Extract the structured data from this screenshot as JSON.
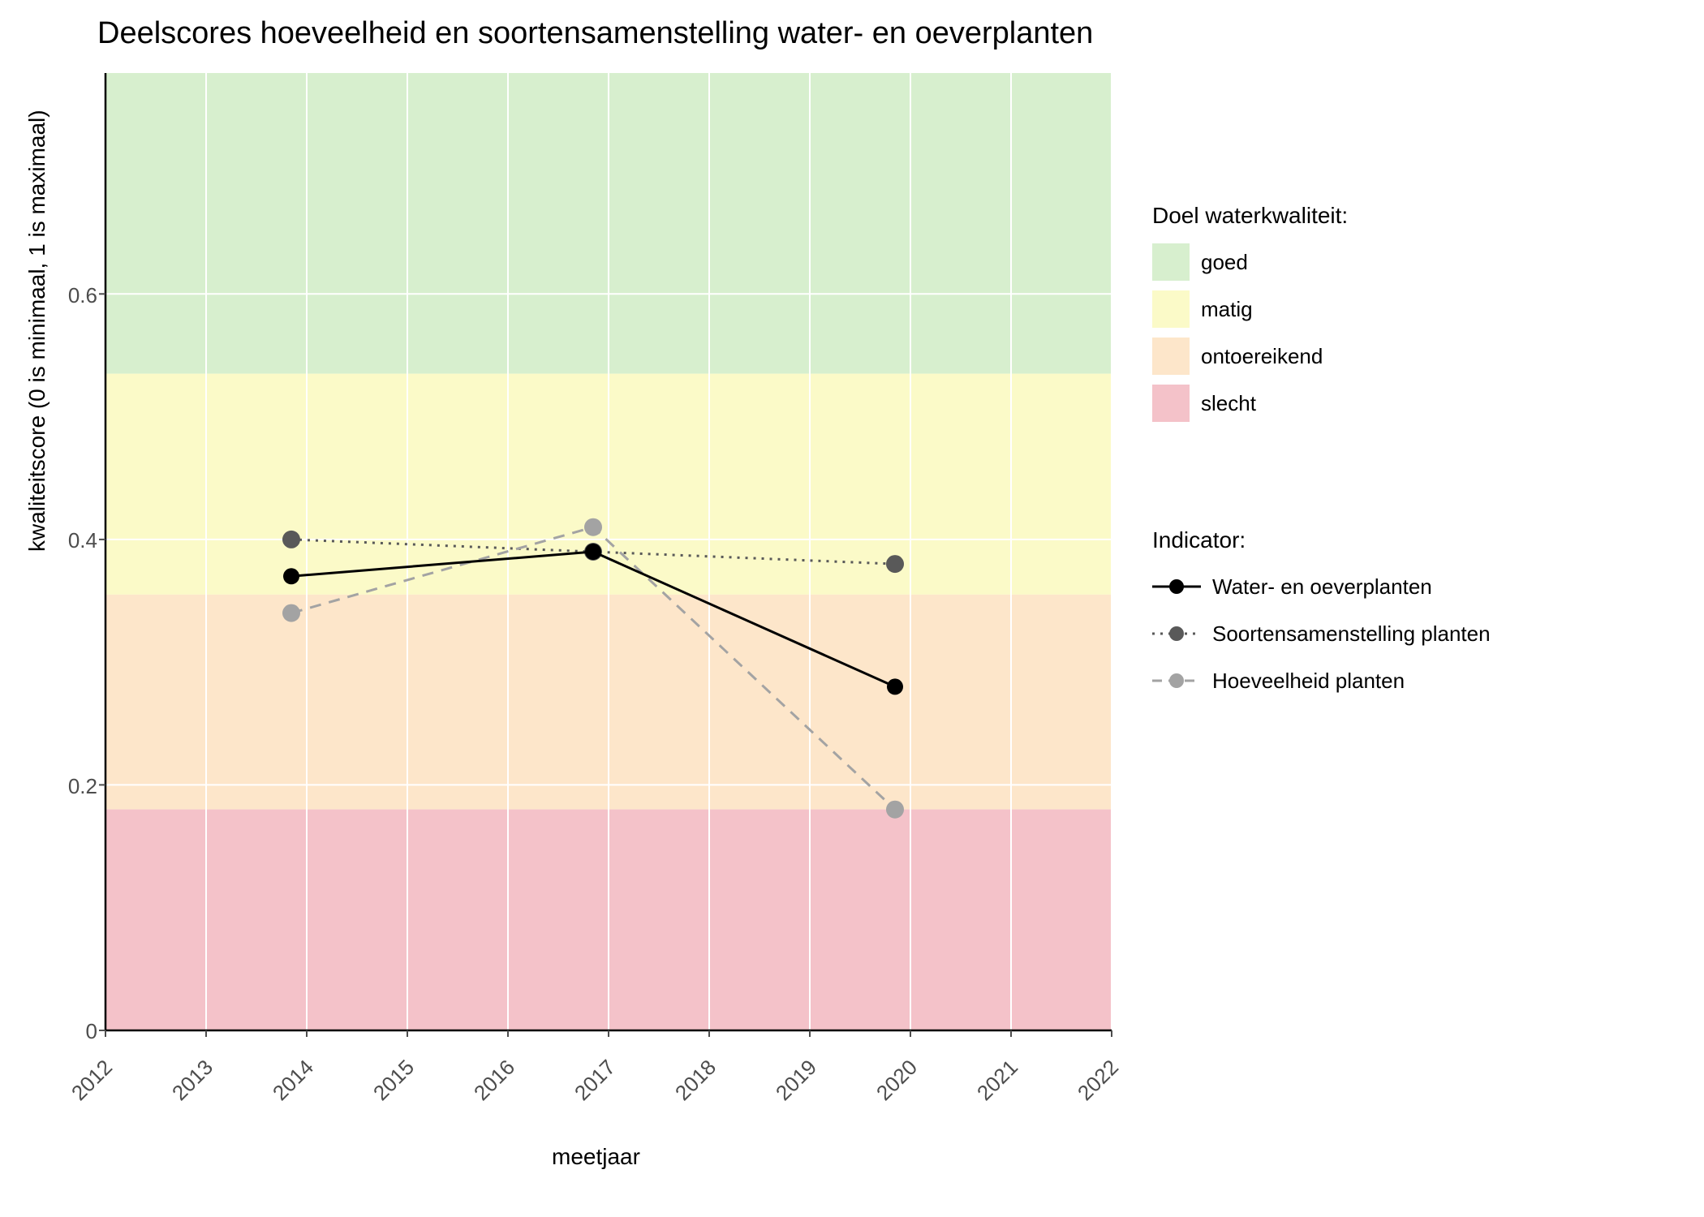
{
  "chart_data": {
    "type": "line",
    "title": "Deelscores hoeveelheid en soortensamenstelling water- en oeverplanten",
    "xlabel": "meetjaar",
    "ylabel": "kwaliteitscore (0 is minimaal, 1 is maximaal)",
    "x_ticks": [
      2012,
      2013,
      2014,
      2015,
      2016,
      2017,
      2018,
      2019,
      2020,
      2021,
      2022
    ],
    "y_ticks": [
      0.0,
      0.2,
      0.4,
      0.6
    ],
    "xlim": [
      2012,
      2022
    ],
    "ylim": [
      0.0,
      0.78
    ],
    "background_bands": [
      {
        "label": "slecht",
        "ymin": 0.0,
        "ymax": 0.18,
        "color": "#f4c2c9"
      },
      {
        "label": "ontoereikend",
        "ymin": 0.18,
        "ymax": 0.355,
        "color": "#fde6ca"
      },
      {
        "label": "matig",
        "ymin": 0.355,
        "ymax": 0.535,
        "color": "#fbfac8"
      },
      {
        "label": "goed",
        "ymin": 0.535,
        "ymax": 0.78,
        "color": "#d7efce"
      }
    ],
    "series": [
      {
        "name": "Water- en oeverplanten",
        "color": "#000000",
        "linestyle": "solid",
        "x": [
          2014,
          2017,
          2020
        ],
        "y": [
          0.37,
          0.39,
          0.28
        ]
      },
      {
        "name": "Soortensamenstelling planten",
        "color": "#595959",
        "linestyle": "dotted",
        "x": [
          2014,
          2017,
          2020
        ],
        "y": [
          0.4,
          0.39,
          0.38
        ]
      },
      {
        "name": "Hoeveelheid planten",
        "color": "#a3a3a3",
        "linestyle": "dashed",
        "x": [
          2014,
          2017,
          2020
        ],
        "y": [
          0.34,
          0.41,
          0.18
        ]
      }
    ],
    "legend_doel_title": "Doel waterkwaliteit:",
    "legend_doel_items": [
      "goed",
      "matig",
      "ontoereikend",
      "slecht"
    ],
    "legend_indicator_title": "Indicator:"
  }
}
